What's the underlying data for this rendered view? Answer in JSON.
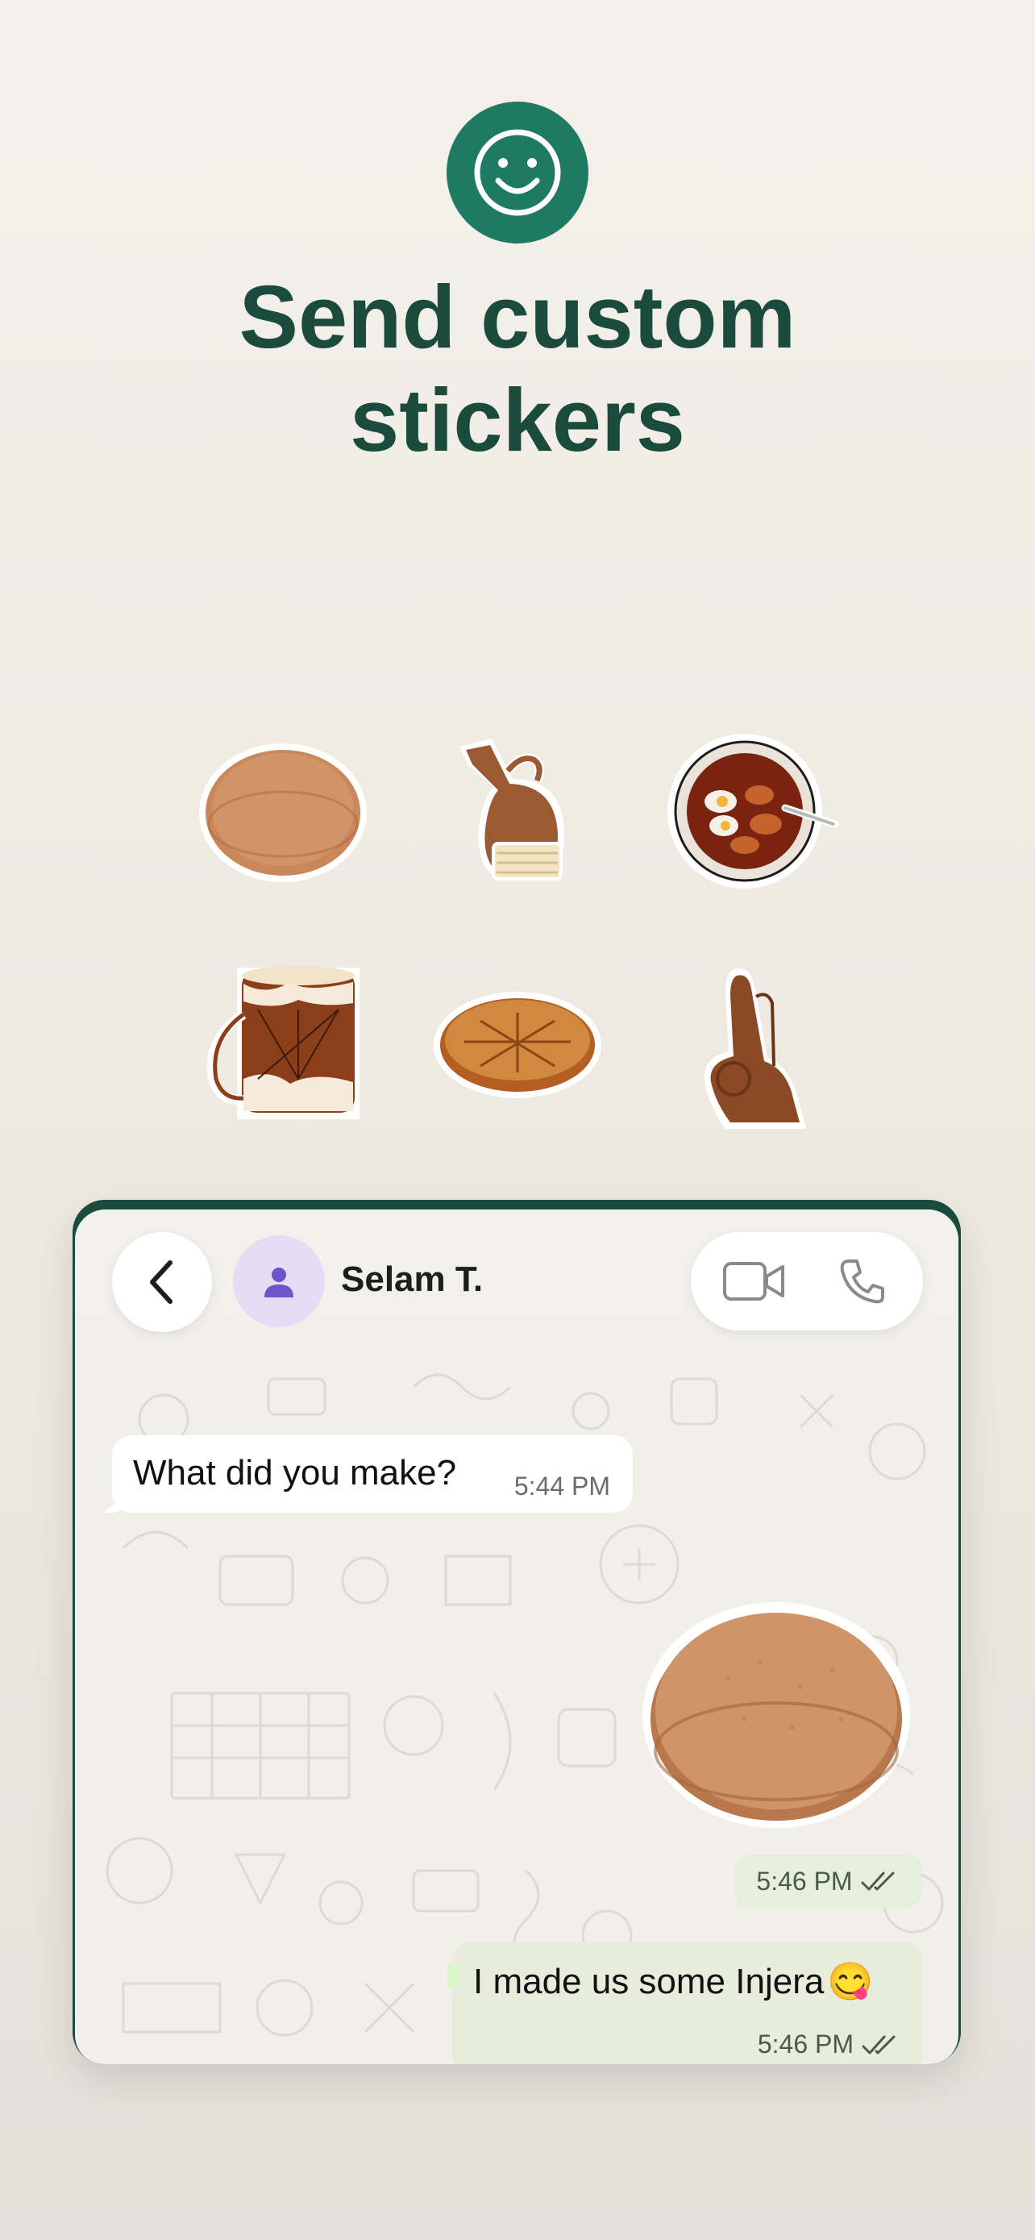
{
  "hero": {
    "icon": "smiley-face-icon",
    "headline_line1": "Send custom",
    "headline_line2": "stickers",
    "accent_color": "#1f7a63",
    "headline_color": "#1b4b3c"
  },
  "sticker_grid": {
    "stickers": [
      {
        "name": "injera-sticker"
      },
      {
        "name": "clay-coffee-pot-sticker"
      },
      {
        "name": "doro-wat-bowl-sticker"
      },
      {
        "name": "drum-sticker"
      },
      {
        "name": "bread-loaf-sticker"
      },
      {
        "name": "crossed-fingers-sticker"
      }
    ]
  },
  "chat": {
    "contact_name": "Selam T.",
    "back_icon": "chevron-left-icon",
    "avatar_icon": "person-icon",
    "video_icon": "video-camera-icon",
    "call_icon": "phone-icon",
    "messages": [
      {
        "direction": "incoming",
        "text": "What did you make?",
        "time": "5:44 PM"
      },
      {
        "direction": "outgoing",
        "type": "sticker",
        "sticker": "injera-sticker",
        "time": "5:46 PM",
        "status": "read"
      },
      {
        "direction": "outgoing",
        "text": "I made us some Injera",
        "emoji": "😋",
        "time": "5:46 PM",
        "status": "read"
      }
    ],
    "read_color": "#4a5a48",
    "avatar_color": "#6b55c9"
  }
}
